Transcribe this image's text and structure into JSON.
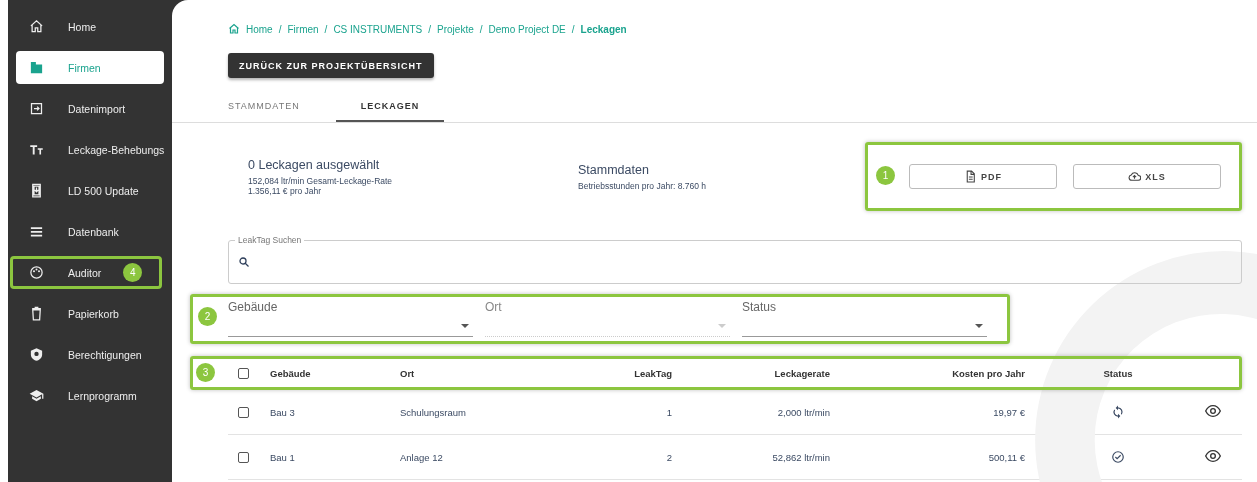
{
  "sidebar": {
    "items": [
      {
        "label": "Home",
        "selected": false
      },
      {
        "label": "Firmen",
        "selected": true
      },
      {
        "label": "Datenimport",
        "selected": false
      },
      {
        "label": "Leckage-Behebungs",
        "selected": false
      },
      {
        "label": "LD 500 Update",
        "selected": false
      },
      {
        "label": "Datenbank",
        "selected": false
      },
      {
        "label": "Auditor",
        "selected": false,
        "annotation": "4"
      },
      {
        "label": "Papierkorb",
        "selected": false
      },
      {
        "label": "Berechtigungen",
        "selected": false
      },
      {
        "label": "Lernprogramm",
        "selected": false
      }
    ]
  },
  "breadcrumb": {
    "items": [
      "Home",
      "Firmen",
      "CS INSTRUMENTS",
      "Projekte",
      "Demo Project DE",
      "Leckagen"
    ],
    "separator": "/"
  },
  "back_button": "ZURÜCK ZUR PROJEKTÜBERSICHT",
  "tabs": [
    {
      "label": "STAMMDATEN",
      "selected": false
    },
    {
      "label": "LECKAGEN",
      "selected": true
    }
  ],
  "summary": {
    "title": "0 Leckagen ausgewählt",
    "lines": [
      "152,084 ltr/min Gesamt-Leckage-Rate",
      "1.356,11 € pro Jahr"
    ]
  },
  "stammdaten": {
    "title": "Stammdaten",
    "lines": [
      "Betriebsstunden pro Jahr: 8.760 h"
    ]
  },
  "export": {
    "annotation": "1",
    "buttons": [
      "PDF",
      "XLS"
    ]
  },
  "search": {
    "label": "LeakTag Suchen"
  },
  "filters": {
    "annotation": "2",
    "fields": [
      {
        "label": "Gebäude",
        "disabled": false
      },
      {
        "label": "Ort",
        "disabled": true
      },
      {
        "label": "Status",
        "disabled": false
      }
    ]
  },
  "table": {
    "annotation": "3",
    "header_checked": false,
    "columns": [
      "Gebäude",
      "Ort",
      "LeakTag",
      "Leckagerate",
      "Kosten pro Jahr",
      "Status"
    ],
    "rows": [
      {
        "checked": false,
        "cells": [
          "Bau 3",
          "Schulungsraum",
          "1",
          "2,000 ltr/min",
          "19,97 €"
        ],
        "kind": "in_progress"
      },
      {
        "checked": false,
        "cells": [
          "Bau 1",
          "Anlage 12",
          "2",
          "52,862 ltr/min",
          "500,11 €"
        ],
        "kind": "done"
      }
    ]
  }
}
